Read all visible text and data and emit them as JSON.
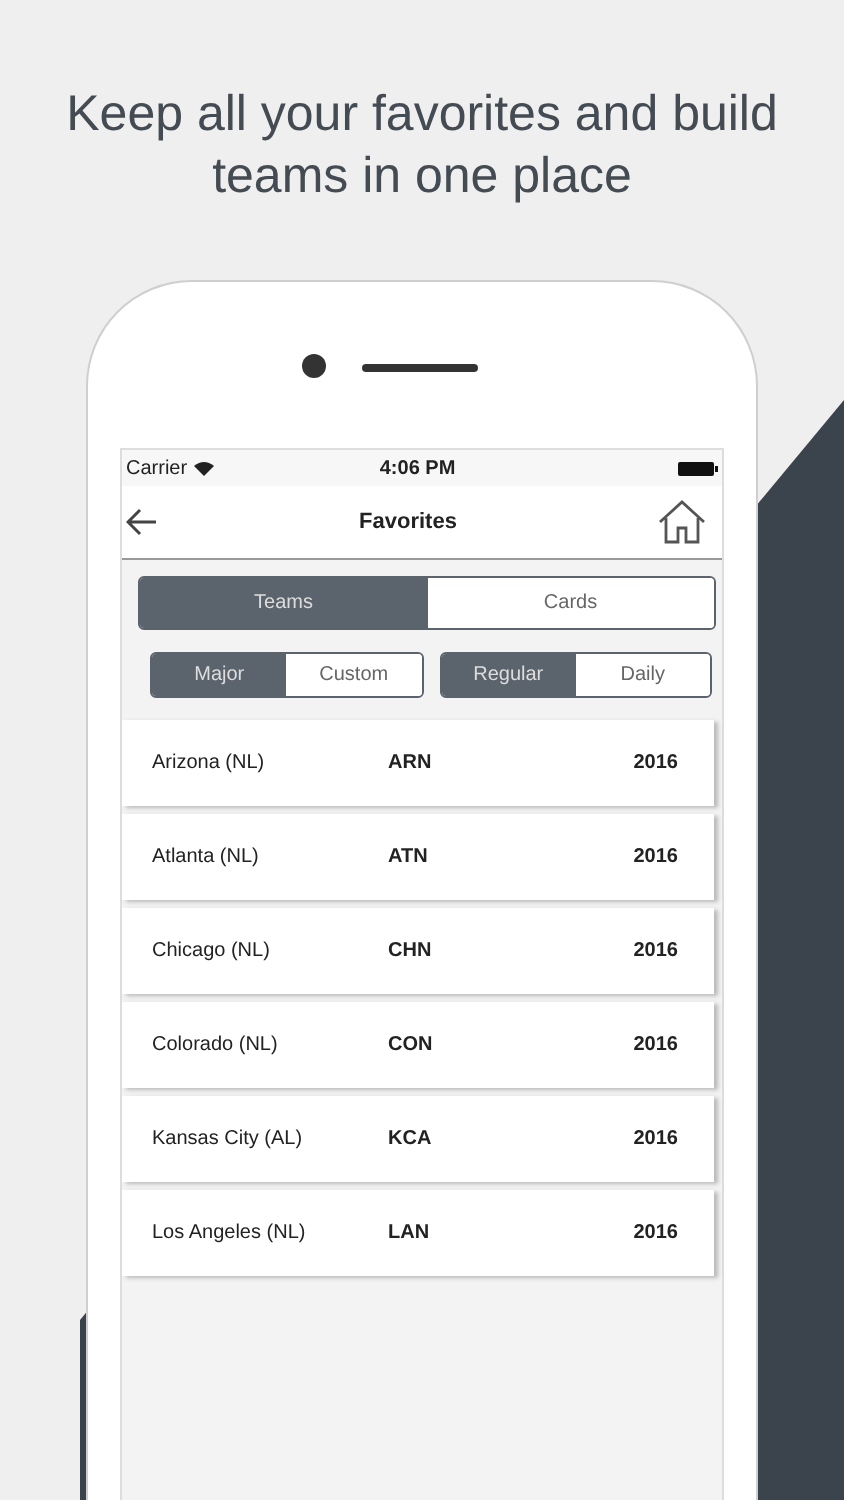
{
  "headline": "Keep all your favorites and build teams in one place",
  "status_bar": {
    "carrier": "Carrier",
    "time": "4:06 PM"
  },
  "nav": {
    "title": "Favorites"
  },
  "tabs": [
    {
      "label": "Teams",
      "selected": true
    },
    {
      "label": "Cards",
      "selected": false
    }
  ],
  "filters": [
    [
      {
        "label": "Major",
        "selected": true
      },
      {
        "label": "Custom",
        "selected": false
      }
    ],
    [
      {
        "label": "Regular",
        "selected": true
      },
      {
        "label": "Daily",
        "selected": false
      }
    ]
  ],
  "rows": [
    {
      "name": "Arizona (NL)",
      "code": "ARN",
      "year": "2016"
    },
    {
      "name": "Atlanta (NL)",
      "code": "ATN",
      "year": "2016"
    },
    {
      "name": "Chicago (NL)",
      "code": "CHN",
      "year": "2016"
    },
    {
      "name": "Colorado (NL)",
      "code": "CON",
      "year": "2016"
    },
    {
      "name": "Kansas City (AL)",
      "code": "KCA",
      "year": "2016"
    },
    {
      "name": "Los Angeles (NL)",
      "code": "LAN",
      "year": "2016"
    }
  ]
}
